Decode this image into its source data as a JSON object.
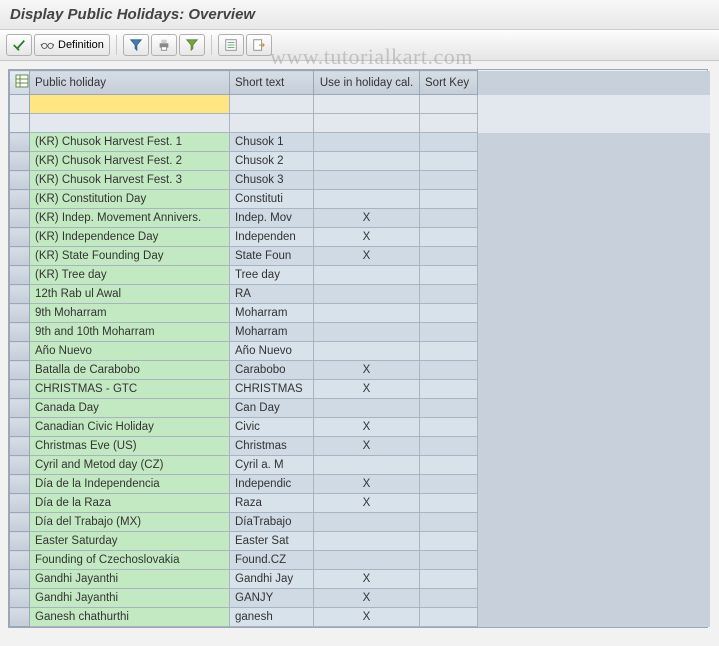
{
  "title": "Display Public Holidays: Overview",
  "watermark": "www.tutorialkart.com",
  "toolbar": {
    "check_label": "",
    "definition_label": "Definition",
    "filter_label": "",
    "print_label": "",
    "sort_label": "",
    "details_label": "",
    "export_label": ""
  },
  "grid": {
    "columns": {
      "name": "Public holiday",
      "short": "Short text",
      "use": "Use in holiday cal.",
      "sortkey": "Sort Key"
    },
    "filter": {
      "name": "",
      "short": "",
      "use": "",
      "sortkey": ""
    },
    "rows": [
      {
        "name": "(KR) Chusok Harvest Fest. 1",
        "short": "Chusok 1",
        "use": "",
        "sortkey": ""
      },
      {
        "name": "(KR) Chusok Harvest Fest. 2",
        "short": "Chusok 2",
        "use": "",
        "sortkey": ""
      },
      {
        "name": "(KR) Chusok Harvest Fest. 3",
        "short": "Chusok 3",
        "use": "",
        "sortkey": ""
      },
      {
        "name": "(KR) Constitution Day",
        "short": "Constituti",
        "use": "",
        "sortkey": ""
      },
      {
        "name": "(KR) Indep. Movement Annivers.",
        "short": "Indep. Mov",
        "use": "X",
        "sortkey": ""
      },
      {
        "name": "(KR) Independence Day",
        "short": "Independen",
        "use": "X",
        "sortkey": ""
      },
      {
        "name": "(KR) State Founding Day",
        "short": "State Foun",
        "use": "X",
        "sortkey": ""
      },
      {
        "name": "(KR) Tree day",
        "short": "Tree day",
        "use": "",
        "sortkey": ""
      },
      {
        "name": "12th Rab ul Awal",
        "short": "RA",
        "use": "",
        "sortkey": ""
      },
      {
        "name": "9th Moharram",
        "short": "Moharram",
        "use": "",
        "sortkey": ""
      },
      {
        "name": "9th and 10th Moharram",
        "short": "Moharram",
        "use": "",
        "sortkey": ""
      },
      {
        "name": "Año Nuevo",
        "short": "Año Nuevo",
        "use": "",
        "sortkey": ""
      },
      {
        "name": "Batalla de Carabobo",
        "short": "Carabobo",
        "use": "X",
        "sortkey": ""
      },
      {
        "name": "CHRISTMAS - GTC",
        "short": "CHRISTMAS",
        "use": "X",
        "sortkey": ""
      },
      {
        "name": "Canada Day",
        "short": "Can Day",
        "use": "",
        "sortkey": ""
      },
      {
        "name": "Canadian Civic Holiday",
        "short": "Civic",
        "use": "X",
        "sortkey": ""
      },
      {
        "name": "Christmas Eve (US)",
        "short": "Christmas",
        "use": "X",
        "sortkey": ""
      },
      {
        "name": "Cyril and Metod day (CZ)",
        "short": "Cyril a. M",
        "use": "",
        "sortkey": ""
      },
      {
        "name": "Día de la Independencia",
        "short": "Independic",
        "use": "X",
        "sortkey": ""
      },
      {
        "name": "Día de la Raza",
        "short": "Raza",
        "use": "X",
        "sortkey": ""
      },
      {
        "name": "Día del Trabajo          (MX)",
        "short": "DíaTrabajo",
        "use": "",
        "sortkey": ""
      },
      {
        "name": "Easter Saturday",
        "short": "Easter Sat",
        "use": "",
        "sortkey": ""
      },
      {
        "name": "Founding of Czechoslovakia",
        "short": "Found.CZ",
        "use": "",
        "sortkey": ""
      },
      {
        "name": "Gandhi Jayanthi",
        "short": "Gandhi Jay",
        "use": "X",
        "sortkey": ""
      },
      {
        "name": "Gandhi Jayanthi",
        "short": "GANJY",
        "use": "X",
        "sortkey": ""
      },
      {
        "name": "Ganesh chathurthi",
        "short": "ganesh",
        "use": "X",
        "sortkey": ""
      }
    ]
  }
}
